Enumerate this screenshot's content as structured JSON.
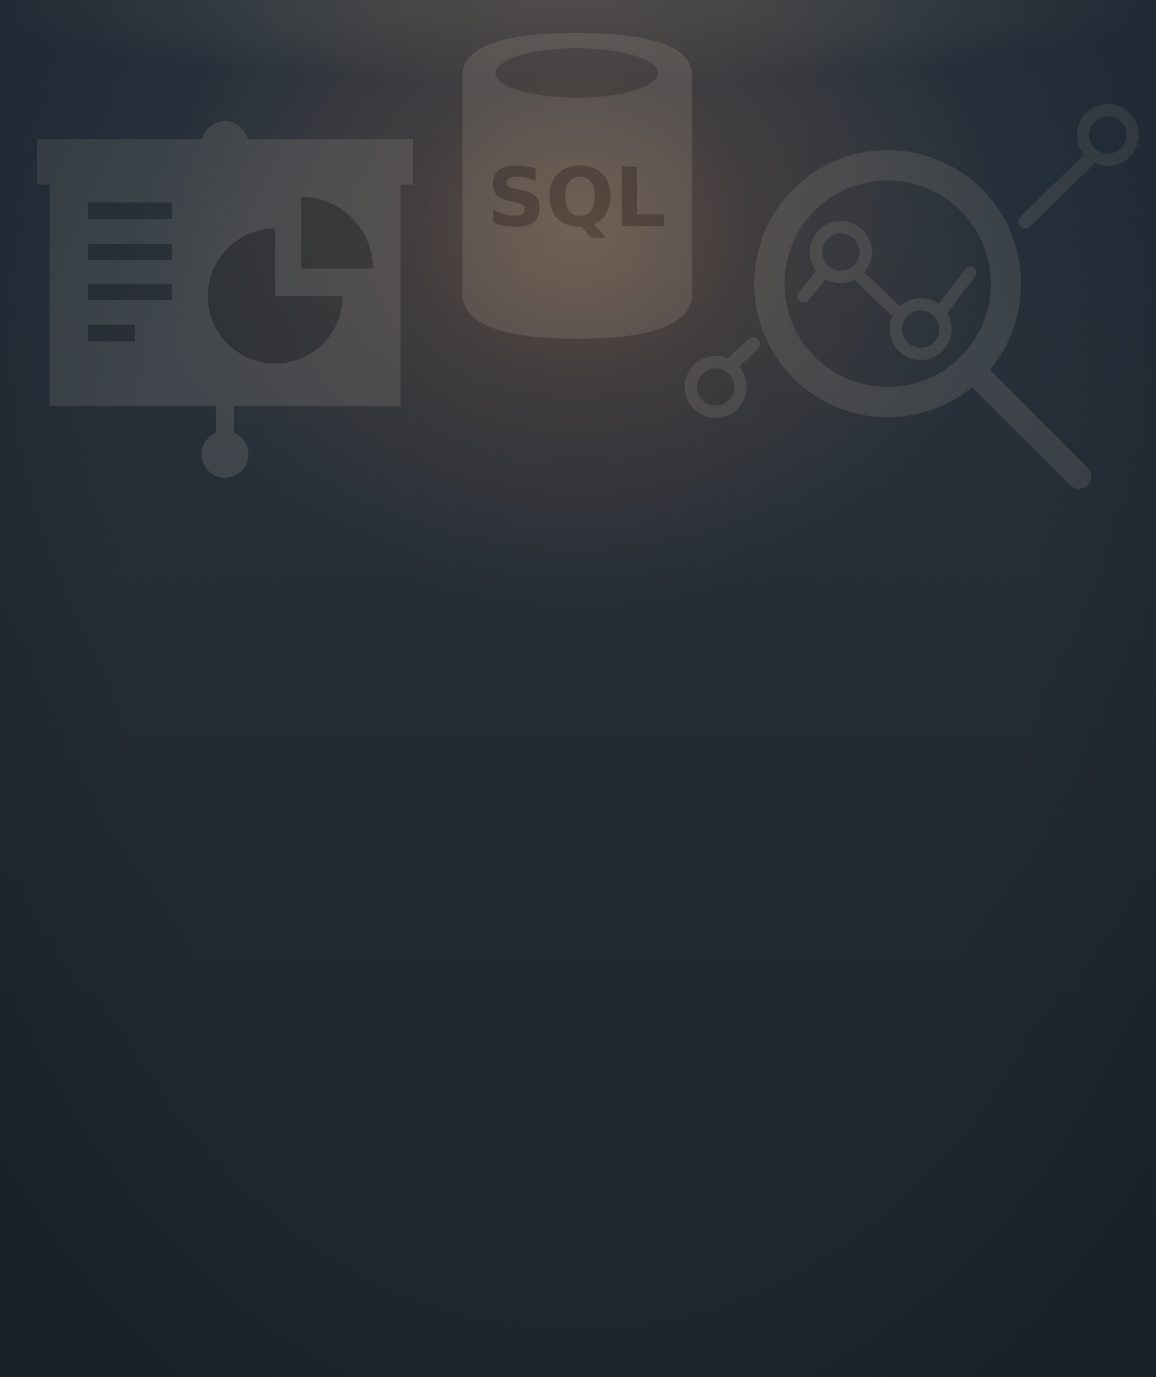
{
  "background": {
    "base_color": "#222831",
    "glow_color": "#6b5448"
  },
  "illustration": {
    "presentation_icon": "presentation-board-pie-chart-icon",
    "database_icon": "sql-database-icon",
    "database_label": "SQL",
    "analytics_icon": "magnifier-line-graph-icon",
    "icon_color": "#8a8680",
    "icon_dark_color": "#3a3634"
  }
}
